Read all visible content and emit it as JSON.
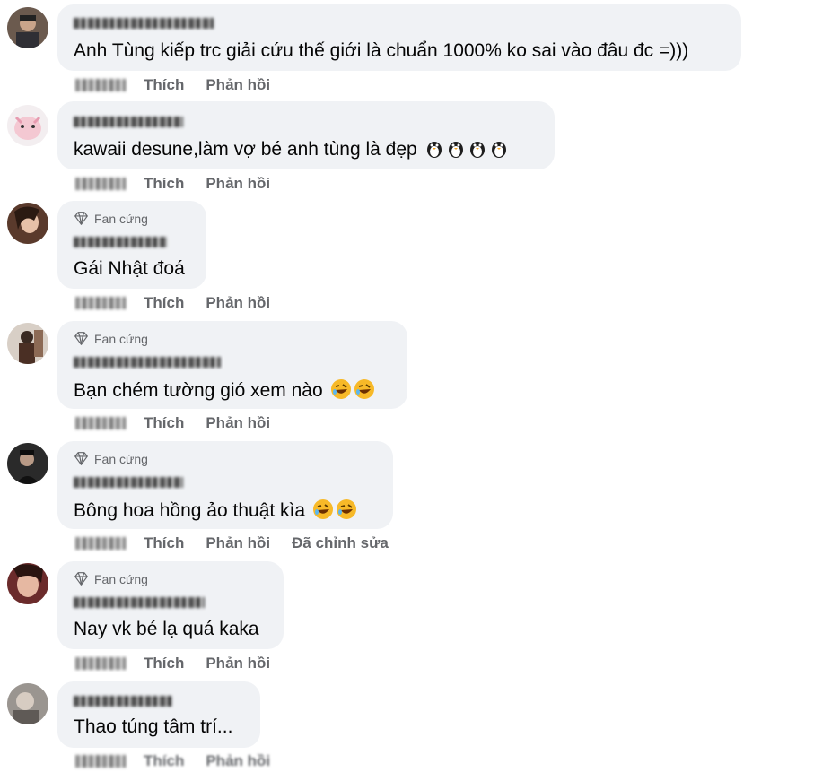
{
  "labels": {
    "like": "Thích",
    "reply": "Phản hồi",
    "fan": "Fan cứng",
    "edited": "Đã chỉnh sửa"
  },
  "comments": [
    {
      "text": "Anh Tùng kiếp trc giải cứu thế giới là chuẩn 1000% ko sai vào đâu đc =)))",
      "badge": "",
      "emoji": ""
    },
    {
      "text": "kawaii desune,làm vợ bé anh tùng là đẹp",
      "badge": "",
      "emoji": "penguin-icon x4"
    },
    {
      "text": "Gái Nhật đoá",
      "badge": "Fan cứng",
      "emoji": ""
    },
    {
      "text": "Bạn chém tường gió xem nào",
      "badge": "Fan cứng",
      "emoji": "rofl-icon x2"
    },
    {
      "text": "Bông hoa hồng ảo thuật kìa",
      "badge": "Fan cứng",
      "emoji": "rofl-icon x2"
    },
    {
      "text": "Nay vk bé lạ quá kaka",
      "badge": "Fan cứng",
      "emoji": ""
    },
    {
      "text": "Thao túng tâm trí...",
      "badge": "",
      "emoji": ""
    }
  ],
  "colors": {
    "bubble": "#f0f2f5",
    "muted": "#65676b",
    "text": "#050505"
  }
}
